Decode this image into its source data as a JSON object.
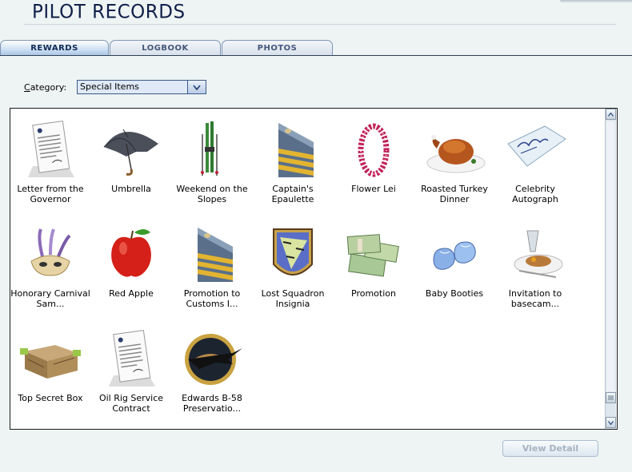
{
  "header": {
    "title": "PILOT RECORDS"
  },
  "tabs": [
    {
      "label": "REWARDS",
      "active": true
    },
    {
      "label": "LOGBOOK",
      "active": false
    },
    {
      "label": "PHOTOS",
      "active": false
    }
  ],
  "category": {
    "label_first": "C",
    "label_rest": "ategory:",
    "selected": "Special Items"
  },
  "items": [
    {
      "label": "Letter from the Governor",
      "icon": "letter-icon"
    },
    {
      "label": "Umbrella",
      "icon": "umbrella-icon"
    },
    {
      "label": "Weekend on the Slopes",
      "icon": "skis-icon"
    },
    {
      "label": "Captain's Epaulette",
      "icon": "epaulette-icon"
    },
    {
      "label": "Flower Lei",
      "icon": "flower-lei-icon"
    },
    {
      "label": "Roasted Turkey Dinner",
      "icon": "turkey-icon"
    },
    {
      "label": "Celebrity Autograph",
      "icon": "autograph-icon"
    },
    {
      "label": "Honorary Carnival Sam...",
      "icon": "carnival-mask-icon"
    },
    {
      "label": "Red Apple",
      "icon": "apple-icon"
    },
    {
      "label": "Promotion to Customs I...",
      "icon": "epaulette-icon"
    },
    {
      "label": "Lost Squadron Insignia",
      "icon": "squadron-insignia-icon"
    },
    {
      "label": "Promotion",
      "icon": "money-stack-icon"
    },
    {
      "label": "Baby Booties",
      "icon": "booties-icon"
    },
    {
      "label": "Invitation to basecam...",
      "icon": "food-plate-icon"
    },
    {
      "label": "Top Secret Box",
      "icon": "crate-icon"
    },
    {
      "label": "Oil Rig Service Contract",
      "icon": "letter-icon"
    },
    {
      "label": "Edwards B-58 Preservatio...",
      "icon": "b58-badge-icon"
    }
  ],
  "footer": {
    "view_detail": "View Detail"
  },
  "colors": {
    "accent": "#3b5a8a",
    "panel_bg": "#ffffff",
    "page_bg": "#eef4f3"
  }
}
